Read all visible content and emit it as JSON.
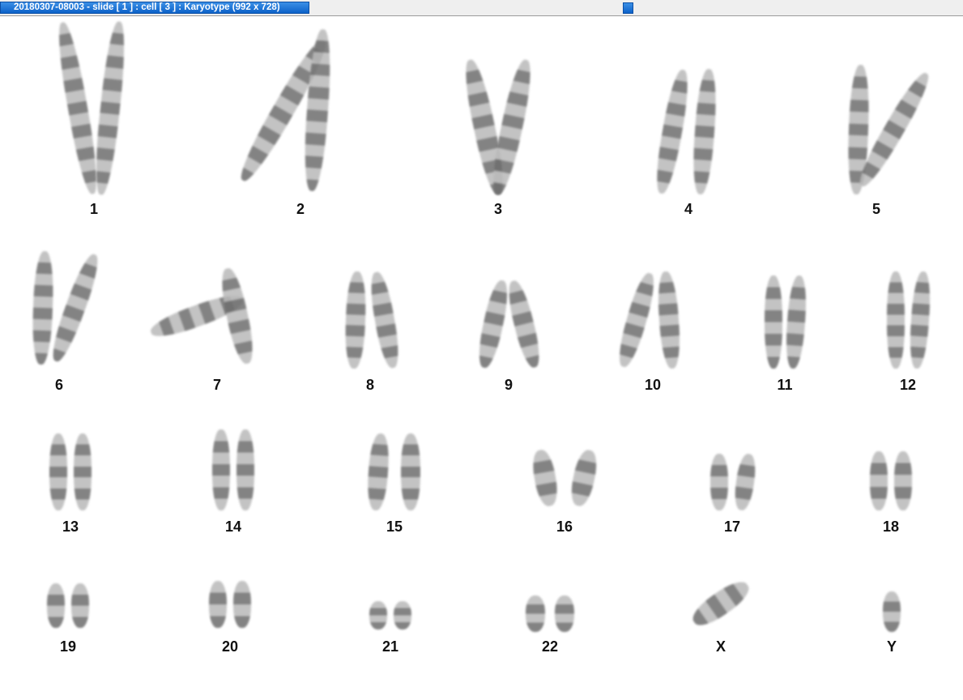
{
  "window": {
    "title": "20180307-08003 - slide [ 1 ] : cell [ 3 ] : Karyotype  (992 x 728)"
  },
  "karyotype": {
    "labels": [
      "1",
      "2",
      "3",
      "4",
      "5",
      "6",
      "7",
      "8",
      "9",
      "10",
      "11",
      "12",
      "13",
      "14",
      "15",
      "16",
      "17",
      "18",
      "19",
      "20",
      "21",
      "22",
      "X",
      "Y"
    ]
  }
}
